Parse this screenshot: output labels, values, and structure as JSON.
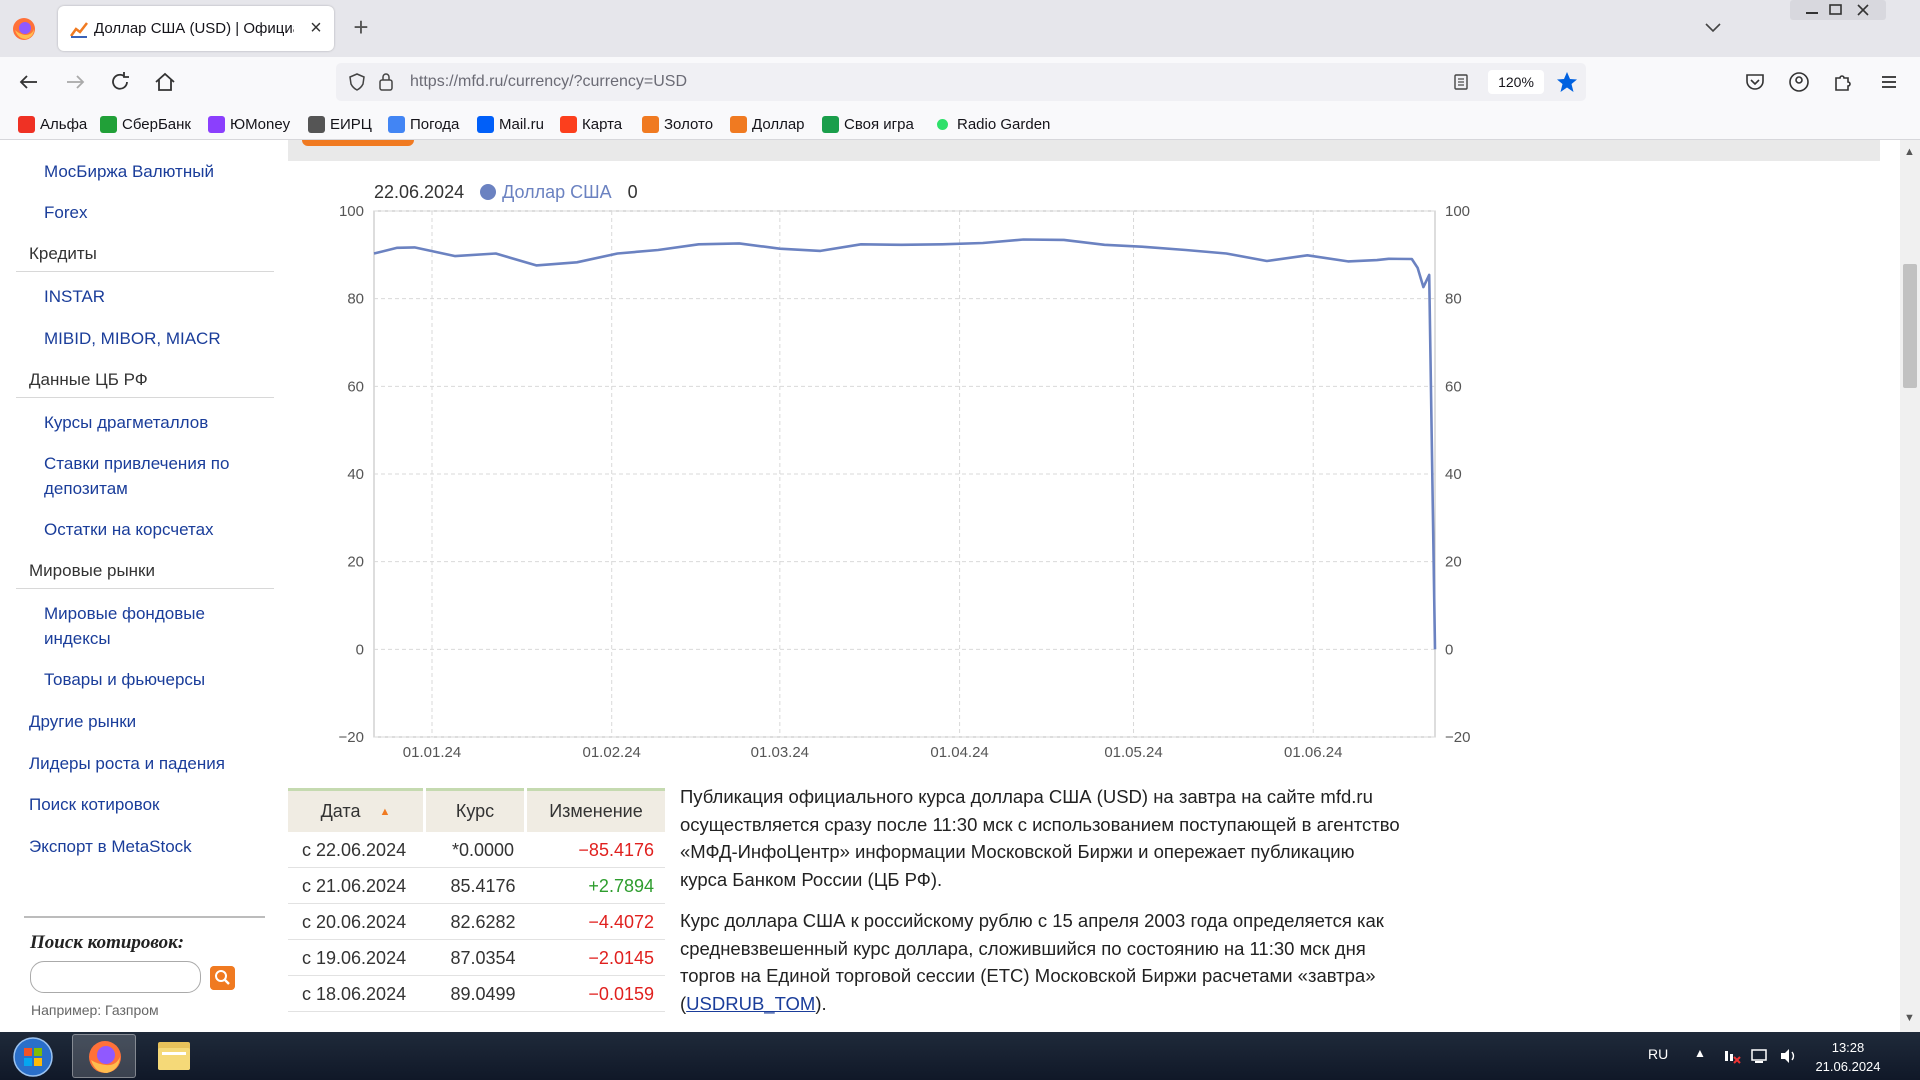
{
  "browser": {
    "tab_title": "Доллар США (USD) | Официал",
    "new_tab_label": "+",
    "url_host": "https://mfd.ru",
    "url_path": "/currency/?currency=USD",
    "zoom": "120%"
  },
  "bookmarks": [
    {
      "label": "Альфа",
      "icon": "alfa-icon",
      "color": "#ef3124"
    },
    {
      "label": "СберБанк",
      "icon": "sber-icon",
      "color": "#21a038"
    },
    {
      "label": "ЮMoney",
      "icon": "yoomoney-icon",
      "color": "#8b3ffd"
    },
    {
      "label": "ЕИРЦ",
      "icon": "globe-icon",
      "color": "#555555"
    },
    {
      "label": "Погода",
      "icon": "google-icon",
      "color": "#4285f4"
    },
    {
      "label": "Mail.ru",
      "icon": "mail-icon",
      "color": "#005ff9"
    },
    {
      "label": "Карта",
      "icon": "yandex-icon",
      "color": "#fc3f1d"
    },
    {
      "label": "Золото",
      "icon": "mfd-icon",
      "color": "#f07a21"
    },
    {
      "label": "Доллар",
      "icon": "mfd-icon",
      "color": "#f07a21"
    },
    {
      "label": "Своя игра",
      "icon": "svoya-igra-icon",
      "color": "#1a9e4b"
    },
    {
      "label": "Radio Garden",
      "icon": "radio-garden-icon",
      "color": "#2ee06a"
    }
  ],
  "sidebar": {
    "items": [
      {
        "label": "МосБиржа Валютный",
        "kind": "sub"
      },
      {
        "label": "Forex",
        "kind": "sub"
      },
      {
        "label": "Кредиты",
        "kind": "head"
      },
      {
        "label": "INSTAR",
        "kind": "sub"
      },
      {
        "label": "MIBID, MIBOR, MIACR",
        "kind": "sub"
      },
      {
        "label": "Данные ЦБ РФ",
        "kind": "head"
      },
      {
        "label": "Курсы драгметаллов",
        "kind": "sub"
      },
      {
        "label": "Ставки привлечения по депозитам",
        "kind": "sub"
      },
      {
        "label": "Остатки на корсчетах",
        "kind": "sub"
      },
      {
        "label": "Мировые рынки",
        "kind": "head"
      },
      {
        "label": "Мировые фондовые индексы",
        "kind": "sub"
      },
      {
        "label": "Товары и фьючерсы",
        "kind": "sub"
      },
      {
        "label": "Другие рынки",
        "kind": "top"
      },
      {
        "label": "Лидеры роста и падения",
        "kind": "top"
      },
      {
        "label": "Поиск котировок",
        "kind": "top"
      },
      {
        "label": "Экспорт в MetaStock",
        "kind": "top"
      }
    ],
    "search_title": "Поиск котировок:",
    "search_example": "Например: Газпром"
  },
  "legend": {
    "date": "22.06.2024",
    "series_name": "Доллар США",
    "value": "0"
  },
  "chart_data": {
    "type": "line",
    "series": [
      {
        "name": "Доллар США",
        "color": "#6b82c1"
      }
    ],
    "x": [
      "2023-12-22",
      "2023-12-26",
      "2023-12-29",
      "2024-01-05",
      "2024-01-12",
      "2024-01-19",
      "2024-01-26",
      "2024-02-02",
      "2024-02-09",
      "2024-02-16",
      "2024-02-23",
      "2024-03-01",
      "2024-03-08",
      "2024-03-15",
      "2024-03-22",
      "2024-03-29",
      "2024-04-05",
      "2024-04-12",
      "2024-04-19",
      "2024-04-26",
      "2024-05-03",
      "2024-05-10",
      "2024-05-17",
      "2024-05-24",
      "2024-05-31",
      "2024-06-07",
      "2024-06-12",
      "2024-06-14",
      "2024-06-18",
      "2024-06-19",
      "2024-06-20",
      "2024-06-21",
      "2024-06-22"
    ],
    "y": [
      90.3,
      91.6,
      91.7,
      89.7,
      90.3,
      87.6,
      88.3,
      90.3,
      91.1,
      92.4,
      92.6,
      91.4,
      90.9,
      92.4,
      92.3,
      92.4,
      92.7,
      93.5,
      93.4,
      92.3,
      91.8,
      91.1,
      90.3,
      88.6,
      89.9,
      88.5,
      88.8,
      89.1,
      89.0499,
      87.0354,
      82.6282,
      85.4176,
      0
    ],
    "xticks": [
      "01.01.24",
      "01.02.24",
      "01.03.24",
      "01.04.24",
      "01.05.24",
      "01.06.24"
    ],
    "yticks": [
      "−20",
      "0",
      "20",
      "40",
      "60",
      "80",
      "100"
    ],
    "ylim": [
      -20,
      100
    ],
    "grid": true,
    "legend": "top-left"
  },
  "table": {
    "headers": [
      "Дата",
      "Курс",
      "Изменение"
    ],
    "rows": [
      {
        "date": "с 22.06.2024",
        "rate": "*0.0000",
        "change": "−85.4176",
        "dir": "neg"
      },
      {
        "date": "с 21.06.2024",
        "rate": "85.4176",
        "change": "+2.7894",
        "dir": "pos"
      },
      {
        "date": "с 20.06.2024",
        "rate": "82.6282",
        "change": "−4.4072",
        "dir": "neg"
      },
      {
        "date": "с 19.06.2024",
        "rate": "87.0354",
        "change": "−2.0145",
        "dir": "neg"
      },
      {
        "date": "с 18.06.2024",
        "rate": "89.0499",
        "change": "−0.0159",
        "dir": "neg"
      }
    ]
  },
  "description": {
    "p1": "Публикация официального курса доллара США (USD) на завтра на сайте mfd.ru осуществляется сразу после 11:30 мск с использованием поступающей в агентство «МФД-ИнфоЦентр» информации Московской Биржи и опережает публикацию курса Банком России (ЦБ РФ).",
    "p2_before": "Курс доллара США к российскому рублю с 15 апреля 2003 года определяется как средневзвешенный курс доллара, сложившийся по состоянию на 11:30 мск дня торгов на Единой торговой сессии (ЕТС) Московской Биржи расчетами «завтра» (",
    "p2_link": "USDRUB_TOM",
    "p2_after": ")."
  },
  "taskbar": {
    "lang": "RU",
    "time": "13:28",
    "date": "21.06.2024"
  }
}
